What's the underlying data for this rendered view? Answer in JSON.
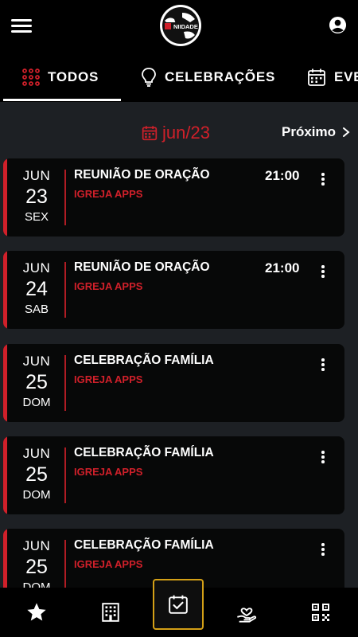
{
  "header": {
    "menu_icon": "hamburger-menu-icon",
    "logo_text": "NIIDADE",
    "profile_icon": "user-account-icon"
  },
  "tabs": [
    {
      "label": "TODOS",
      "icon": "dots-grid-icon",
      "active": true
    },
    {
      "label": "CELEBRAÇÕES",
      "icon": "lightbulb-icon",
      "active": false
    },
    {
      "label": "EVENTOS",
      "icon": "calendar-icon",
      "active": false
    }
  ],
  "month_nav": {
    "current": "jun/23",
    "next_label": "Próximo",
    "accent": "#d0202a"
  },
  "events": [
    {
      "month": "JUN",
      "day": "23",
      "weekday": "SEX",
      "title": "REUNIÃO DE ORAÇÃO",
      "org": "IGREJA APPS",
      "time": "21:00"
    },
    {
      "month": "JUN",
      "day": "24",
      "weekday": "SAB",
      "title": "REUNIÃO DE ORAÇÃO",
      "org": "IGREJA APPS",
      "time": "21:00"
    },
    {
      "month": "JUN",
      "day": "25",
      "weekday": "DOM",
      "title": "CELEBRAÇÃO FAMÍLIA",
      "org": "IGREJA APPS",
      "time": ""
    },
    {
      "month": "JUN",
      "day": "25",
      "weekday": "DOM",
      "title": "CELEBRAÇÃO FAMÍLIA",
      "org": "IGREJA APPS",
      "time": ""
    },
    {
      "month": "JUN",
      "day": "25",
      "weekday": "DOM",
      "title": "CELEBRAÇÃO FAMÍLIA",
      "org": "IGREJA APPS",
      "time": ""
    }
  ],
  "bottom_nav": [
    {
      "icon": "star-icon",
      "active": false
    },
    {
      "icon": "building-icon",
      "active": false
    },
    {
      "icon": "calendar-check-icon",
      "active": true
    },
    {
      "icon": "heart-hand-icon",
      "active": false
    },
    {
      "icon": "qr-code-icon",
      "active": false
    }
  ],
  "colors": {
    "background": "#1d2024",
    "card": "#070808",
    "accent": "#d0202a",
    "active_border": "#d4a017"
  }
}
